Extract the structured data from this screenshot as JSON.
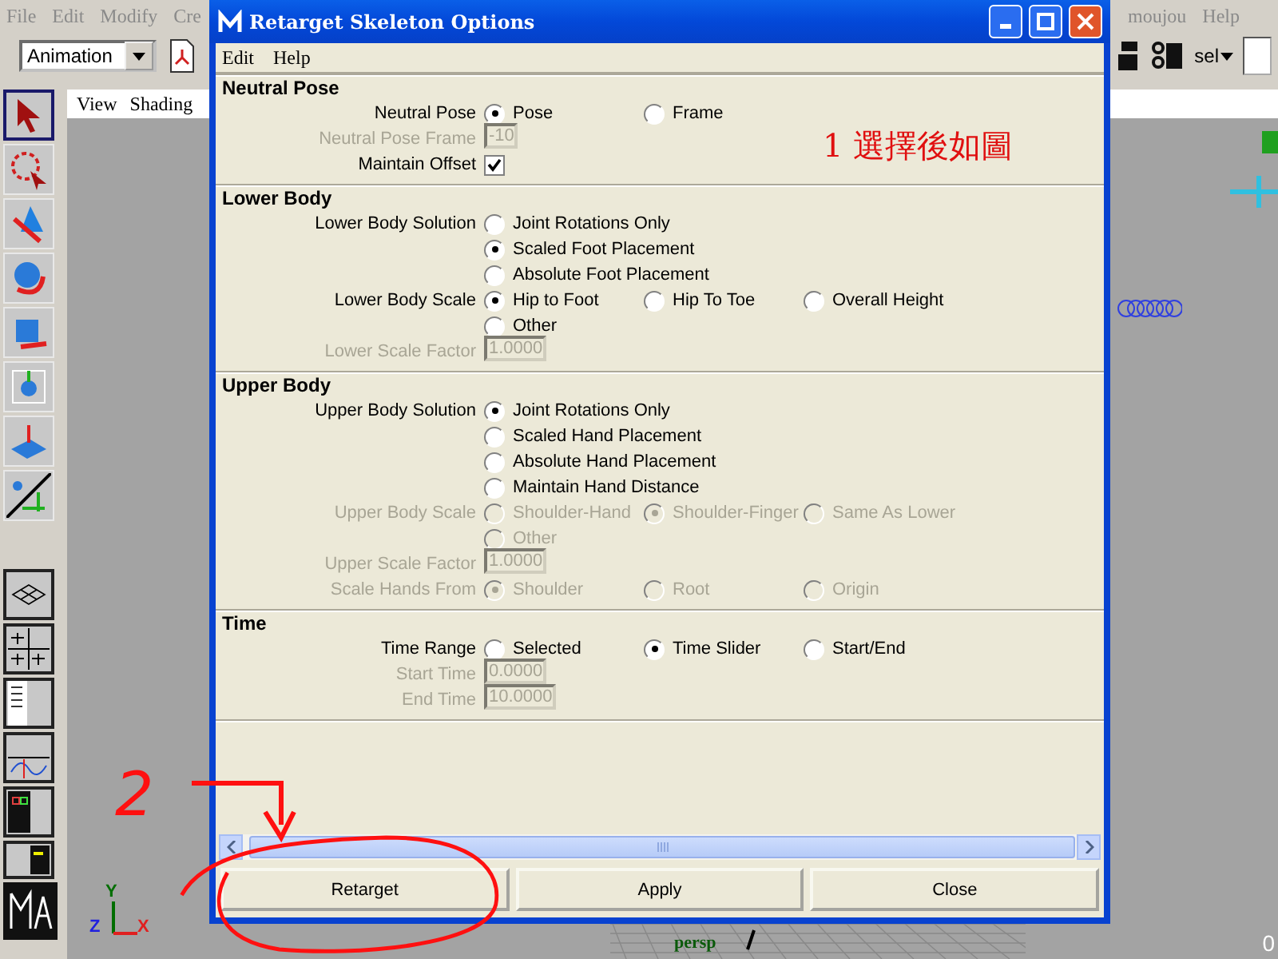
{
  "app": {
    "menus_left": [
      "File",
      "Edit",
      "Modify",
      "Cre"
    ],
    "menus_right": [
      "moujou",
      "Help"
    ],
    "menu_set": "Animation",
    "selection_mode": "sel",
    "panel_menus": [
      "View",
      "Shading"
    ],
    "camera_label": "persp",
    "frame_label": "0",
    "axes": [
      {
        "label": "Y",
        "color": "#006e00"
      },
      {
        "label": "Z",
        "color": "#2020e0"
      },
      {
        "label": "X",
        "color": "#e02020"
      }
    ]
  },
  "dialog": {
    "title": "Retarget Skeleton Options",
    "menus": [
      "Edit",
      "Help"
    ],
    "sections": [
      {
        "title": "Neutral Pose",
        "rows": [
          {
            "kind": "radio",
            "label": "Neutral Pose",
            "disabled": false,
            "lines": [
              [
                {
                  "label": "Pose",
                  "selected": true
                },
                {
                  "label": "Frame",
                  "selected": false
                }
              ]
            ]
          },
          {
            "kind": "field",
            "label": "Neutral Pose Frame",
            "disabled": true,
            "value": "-10"
          },
          {
            "kind": "checkbox",
            "label": "Maintain Offset",
            "disabled": false,
            "checked": true
          }
        ]
      },
      {
        "title": "Lower Body",
        "rows": [
          {
            "kind": "radio",
            "label": "Lower Body Solution",
            "disabled": false,
            "lines": [
              [
                {
                  "label": "Joint Rotations Only",
                  "selected": false
                }
              ],
              [
                {
                  "label": "Scaled Foot Placement",
                  "selected": true
                }
              ],
              [
                {
                  "label": "Absolute Foot Placement",
                  "selected": false
                }
              ]
            ]
          },
          {
            "kind": "radio",
            "label": "Lower Body Scale",
            "disabled": false,
            "lines": [
              [
                {
                  "label": "Hip to Foot",
                  "selected": true
                },
                {
                  "label": "Hip To Toe",
                  "selected": false
                },
                {
                  "label": "Overall Height",
                  "selected": false
                }
              ],
              [
                {
                  "label": "Other",
                  "selected": false
                }
              ]
            ]
          },
          {
            "kind": "field",
            "label": "Lower Scale Factor",
            "disabled": true,
            "value": "1.0000"
          }
        ]
      },
      {
        "title": "Upper Body",
        "rows": [
          {
            "kind": "radio",
            "label": "Upper Body Solution",
            "disabled": false,
            "lines": [
              [
                {
                  "label": "Joint Rotations Only",
                  "selected": true
                }
              ],
              [
                {
                  "label": "Scaled Hand Placement",
                  "selected": false
                }
              ],
              [
                {
                  "label": "Absolute Hand Placement",
                  "selected": false
                }
              ],
              [
                {
                  "label": "Maintain Hand Distance",
                  "selected": false
                }
              ]
            ]
          },
          {
            "kind": "radio",
            "label": "Upper Body Scale",
            "disabled": true,
            "lines": [
              [
                {
                  "label": "Shoulder-Hand",
                  "selected": false
                },
                {
                  "label": "Shoulder-Finger",
                  "selected": true
                },
                {
                  "label": "Same As Lower",
                  "selected": false
                }
              ],
              [
                {
                  "label": "Other",
                  "selected": false
                }
              ]
            ]
          },
          {
            "kind": "field",
            "label": "Upper Scale Factor",
            "disabled": true,
            "value": "1.0000"
          },
          {
            "kind": "radio",
            "label": "Scale Hands From",
            "disabled": true,
            "lines": [
              [
                {
                  "label": "Shoulder",
                  "selected": true
                },
                {
                  "label": "Root",
                  "selected": false
                },
                {
                  "label": "Origin",
                  "selected": false
                }
              ]
            ]
          }
        ]
      },
      {
        "title": "Time",
        "rows": [
          {
            "kind": "radio",
            "label": "Time Range",
            "disabled": false,
            "lines": [
              [
                {
                  "label": "Selected",
                  "selected": false
                },
                {
                  "label": "Time Slider",
                  "selected": true
                },
                {
                  "label": "Start/End",
                  "selected": false
                }
              ]
            ]
          },
          {
            "kind": "field",
            "label": "Start Time",
            "disabled": true,
            "value": "0.0000"
          },
          {
            "kind": "field",
            "label": "End Time",
            "disabled": true,
            "value": "10.0000"
          }
        ]
      }
    ],
    "buttons": [
      "Retarget",
      "Apply",
      "Close"
    ]
  },
  "annotations": {
    "step_1": "1 選擇後如圖",
    "step_2": "2"
  }
}
